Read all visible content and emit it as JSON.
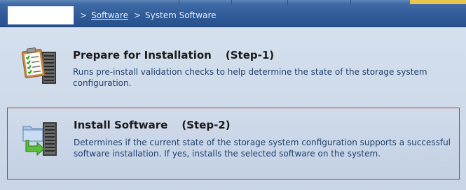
{
  "breadcrumb": {
    "separator": ">",
    "items": [
      {
        "label": "Software",
        "link": true
      },
      {
        "label": "System Software",
        "link": false
      }
    ]
  },
  "options": [
    {
      "title": "Prepare for Installation",
      "step": "(Step-1)",
      "description": "Runs pre-install validation checks to help determine the state of the storage system configuration.",
      "icon": "clipboard-checklist-icon",
      "selected": false
    },
    {
      "title": "Install Software",
      "step": "(Step-2)",
      "description": "Determines if the current state of the storage system configuration supports a successful software installation. If yes, installs the selected software on the system.",
      "icon": "install-to-server-icon",
      "selected": true
    }
  ],
  "colors": {
    "header_bar": "#2e5a97",
    "selection_border": "#b33a3a",
    "description_text": "#1f3f6e"
  }
}
